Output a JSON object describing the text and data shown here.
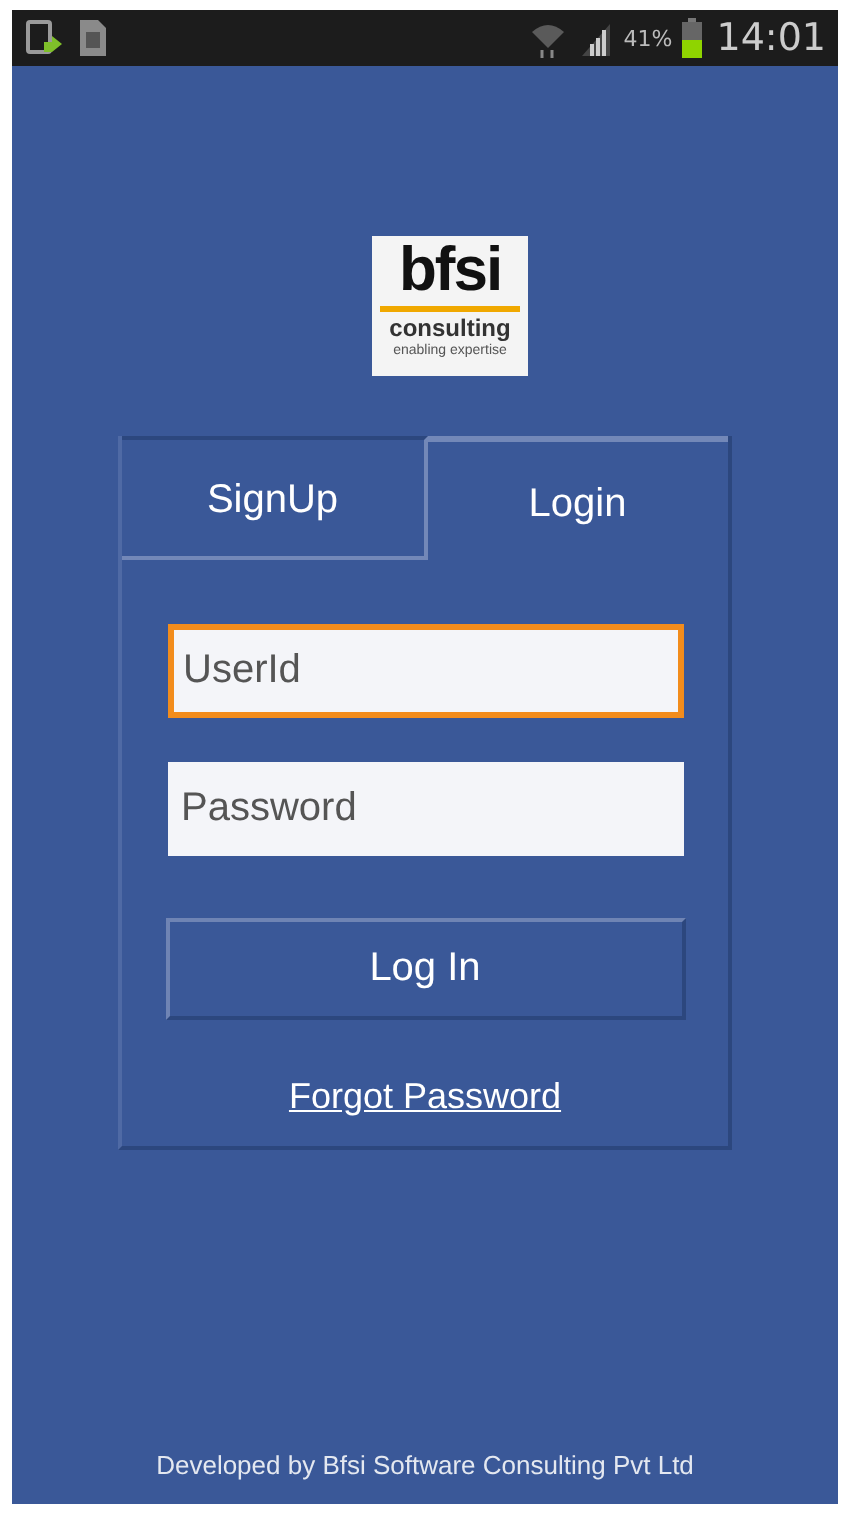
{
  "status_bar": {
    "battery_percent": "41%",
    "time": "14:01"
  },
  "logo": {
    "name": "bfsi",
    "subtitle": "consulting",
    "tagline": "enabling expertise"
  },
  "tabs": [
    {
      "label": "SignUp",
      "selected": false
    },
    {
      "label": "Login",
      "selected": true
    }
  ],
  "fields": [
    {
      "placeholder": "UserId",
      "focused": true
    },
    {
      "placeholder": "Password",
      "focused": false
    }
  ],
  "login_button": "Log In",
  "forgot_link": "Forgot Password",
  "footer": "Developed by Bfsi Software Consulting Pvt Ltd"
}
